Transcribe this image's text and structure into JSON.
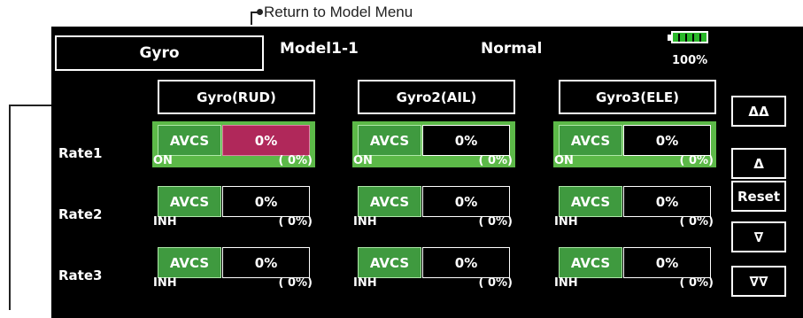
{
  "callout": {
    "return_label": "Return to Model Menu"
  },
  "header": {
    "title": "Gyro",
    "model": "Model1-1",
    "condition": "Normal",
    "battery_percent": "100%",
    "battery_level": 1.0
  },
  "gyros": [
    {
      "label": "Gyro(RUD)"
    },
    {
      "label": "Gyro2(AIL)"
    },
    {
      "label": "Gyro3(ELE)"
    }
  ],
  "rates": [
    {
      "label": "Rate1",
      "cells": [
        {
          "mode": "AVCS",
          "value": "0%",
          "switch": "ON",
          "pct": "( 0%)",
          "active": true,
          "selected": true
        },
        {
          "mode": "AVCS",
          "value": "0%",
          "switch": "ON",
          "pct": "( 0%)",
          "active": true,
          "selected": false
        },
        {
          "mode": "AVCS",
          "value": "0%",
          "switch": "ON",
          "pct": "( 0%)",
          "active": true,
          "selected": false
        }
      ]
    },
    {
      "label": "Rate2",
      "cells": [
        {
          "mode": "AVCS",
          "value": "0%",
          "switch": "INH",
          "pct": "( 0%)",
          "active": false,
          "selected": false
        },
        {
          "mode": "AVCS",
          "value": "0%",
          "switch": "INH",
          "pct": "( 0%)",
          "active": false,
          "selected": false
        },
        {
          "mode": "AVCS",
          "value": "0%",
          "switch": "INH",
          "pct": "( 0%)",
          "active": false,
          "selected": false
        }
      ]
    },
    {
      "label": "Rate3",
      "cells": [
        {
          "mode": "AVCS",
          "value": "0%",
          "switch": "INH",
          "pct": "( 0%)",
          "active": false,
          "selected": false
        },
        {
          "mode": "AVCS",
          "value": "0%",
          "switch": "INH",
          "pct": "( 0%)",
          "active": false,
          "selected": false
        },
        {
          "mode": "AVCS",
          "value": "0%",
          "switch": "INH",
          "pct": "( 0%)",
          "active": false,
          "selected": false
        }
      ]
    }
  ],
  "nav": {
    "up_fast": "ΔΔ",
    "up": "Δ",
    "reset": "Reset",
    "down": "∇",
    "down_fast": "∇∇"
  },
  "colors": {
    "active_row_bg": "#5cb948",
    "mode_bg": "#3f9a3f",
    "selected_value_bg": "#b0285a",
    "battery": "#2ab82a"
  }
}
